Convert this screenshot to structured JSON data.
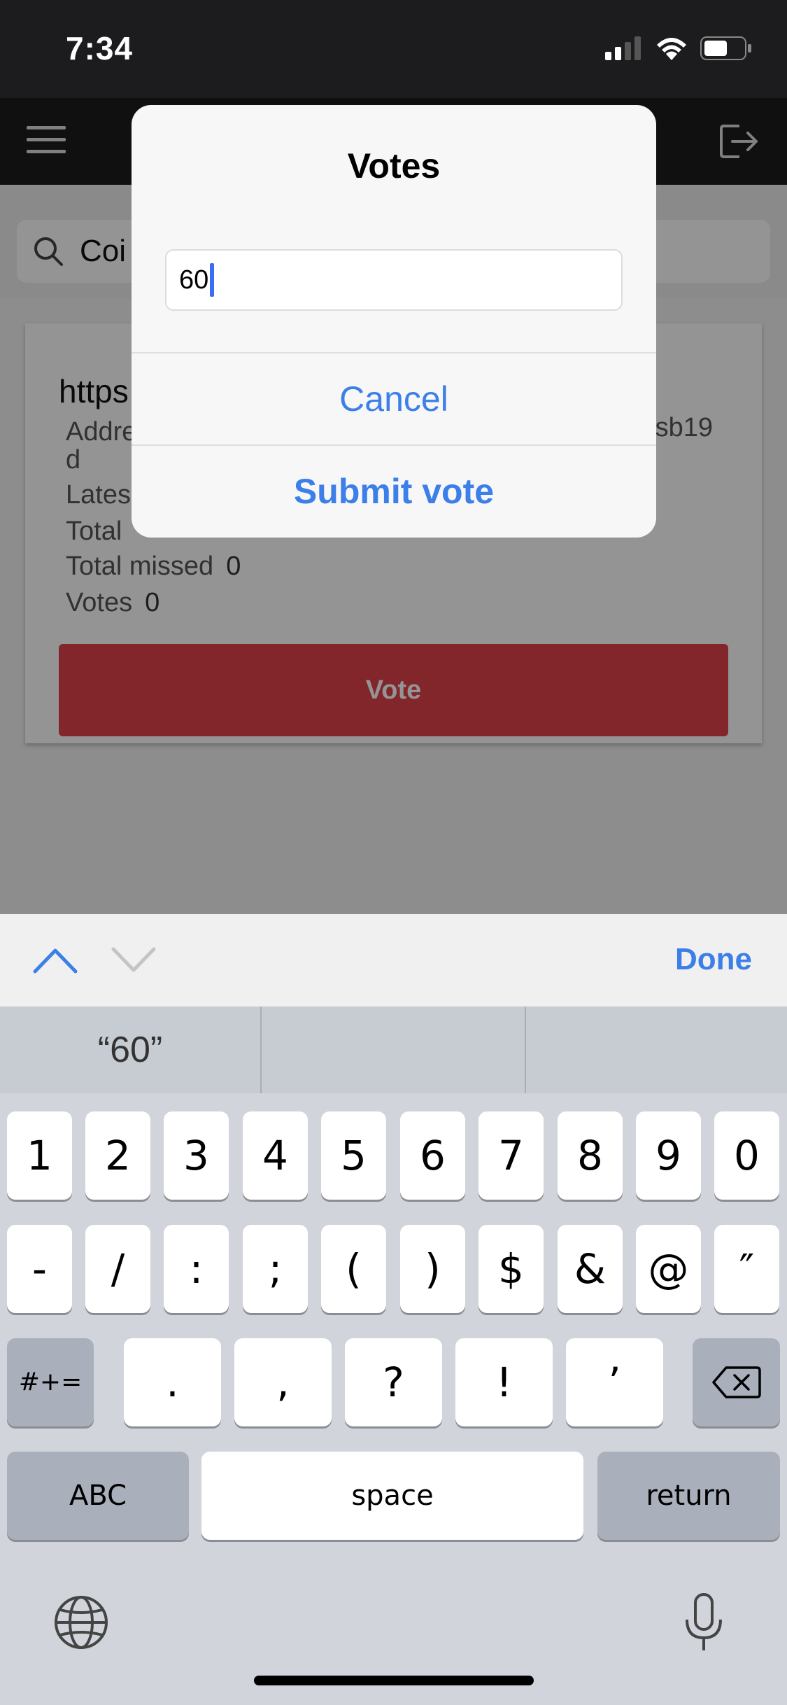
{
  "status_bar": {
    "time": "7:34"
  },
  "search": {
    "value": "Coi"
  },
  "card": {
    "title": "https",
    "address_label": "Addre",
    "address_suffix": "sb19",
    "address_wrap": "d",
    "latest_label": "Lates",
    "total_label": "Total",
    "total_missed_label": "Total missed",
    "total_missed_value": "0",
    "votes_label": "Votes",
    "votes_value": "0",
    "vote_button": "Vote"
  },
  "alert": {
    "title": "Votes",
    "input_value": "60",
    "cancel_label": "Cancel",
    "submit_label": "Submit vote"
  },
  "accessory": {
    "done_label": "Done"
  },
  "keyboard": {
    "suggestion": "“60”",
    "row1": [
      "1",
      "2",
      "3",
      "4",
      "5",
      "6",
      "7",
      "8",
      "9",
      "0"
    ],
    "row2": [
      "-",
      "/",
      ":",
      ";",
      "(",
      ")",
      "$",
      "&",
      "@",
      "″"
    ],
    "row3": [
      ".",
      ",",
      "?",
      "!",
      "’"
    ],
    "symbols_label": "#+=",
    "abc_label": "ABC",
    "space_label": "space",
    "return_label": "return"
  },
  "colors": {
    "accent": "#3c7fe8",
    "vote_button": "#e0434d",
    "caret": "#3b6ef5"
  }
}
